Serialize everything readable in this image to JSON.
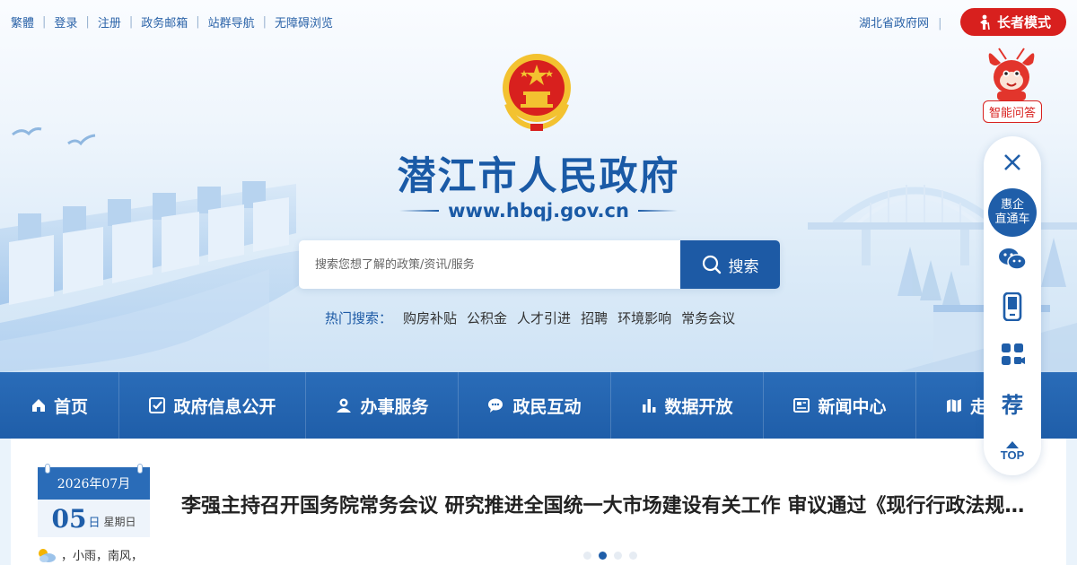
{
  "topbar": {
    "links": [
      "繁體",
      "登录",
      "注册",
      "政务邮箱",
      "站群导航",
      "无障碍浏览"
    ],
    "province_link": "湖北省政府网",
    "province_sep": "|",
    "elder_mode": "长者模式"
  },
  "header": {
    "title": "潜江市人民政府",
    "url": "www.hbqj.gov.cn"
  },
  "search": {
    "placeholder": "搜索您想了解的政策/资讯/服务",
    "button_label": "搜索",
    "hot_label": "热门搜索：",
    "hot_items": [
      "购房补贴",
      "公积金",
      "人才引进",
      "招聘",
      "环境影响",
      "常务会议"
    ]
  },
  "nav": {
    "items": [
      {
        "label": "首页",
        "icon": "home-icon"
      },
      {
        "label": "政府信息公开",
        "icon": "checklist-icon"
      },
      {
        "label": "办事服务",
        "icon": "user-service-icon"
      },
      {
        "label": "政民互动",
        "icon": "chat-icon"
      },
      {
        "label": "数据开放",
        "icon": "bar-chart-icon"
      },
      {
        "label": "新闻中心",
        "icon": "news-icon"
      },
      {
        "label": "走",
        "icon": "map-icon"
      }
    ]
  },
  "calendar": {
    "year_month": "2026年07月",
    "day": "05",
    "day_suffix": "日",
    "weekday": "星期日"
  },
  "weather": {
    "text": "，小雨，南风，",
    "icon": "cloud-sun-icon"
  },
  "news": {
    "headline": "李强主持召开国务院常务会议 研究推进全国统一大市场建设有关工作 审议通过《现行行政法规清理方案》",
    "slides_total": 4,
    "slide_active": 2
  },
  "floating": {
    "assistant_label": "智能问答",
    "close_icon": "close-icon",
    "huiqi_line1": "惠企",
    "huiqi_line2": "直通车",
    "icons": [
      "wechat-icon",
      "mobile-icon",
      "miniprogram-icon",
      "jian-icon"
    ],
    "jian_char": "荐",
    "top_label": "TOP"
  },
  "colors": {
    "primary": "#1f5ea9",
    "accent_red": "#d8201e",
    "nav_bg": "#2a6cb8"
  }
}
